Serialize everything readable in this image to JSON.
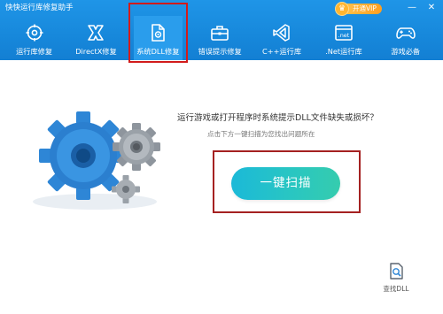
{
  "app": {
    "title": "快快运行库修复助手"
  },
  "vip": {
    "label": "开通VIP"
  },
  "window_controls": {
    "minimize": "—",
    "close": "✕"
  },
  "nav": {
    "items": [
      {
        "label": "运行库修复",
        "icon": "runtime-repair-icon"
      },
      {
        "label": "DirectX修复",
        "icon": "directx-icon"
      },
      {
        "label": "系统DLL修复",
        "icon": "dll-file-icon",
        "active": true
      },
      {
        "label": "错误提示修复",
        "icon": "toolbox-icon"
      },
      {
        "label": "C++运行库",
        "icon": "visual-studio-icon"
      },
      {
        "label": ".Net运行库",
        "icon": "dotnet-icon"
      },
      {
        "label": "游戏必备",
        "icon": "gamepad-icon"
      }
    ]
  },
  "main": {
    "question": "运行游戏或打开程序时系统提示DLL文件缺失或损坏？",
    "hint": "点击下方一键扫描为您找出问题所在",
    "scan_button": "一键扫描",
    "find_dll": "查找DLL"
  },
  "colors": {
    "header_blue": "#1788db",
    "highlight_red": "#d21b1b",
    "scan_gradient_start": "#1bb9d8",
    "scan_gradient_end": "#35ccae",
    "vip_orange": "#ffa525"
  }
}
